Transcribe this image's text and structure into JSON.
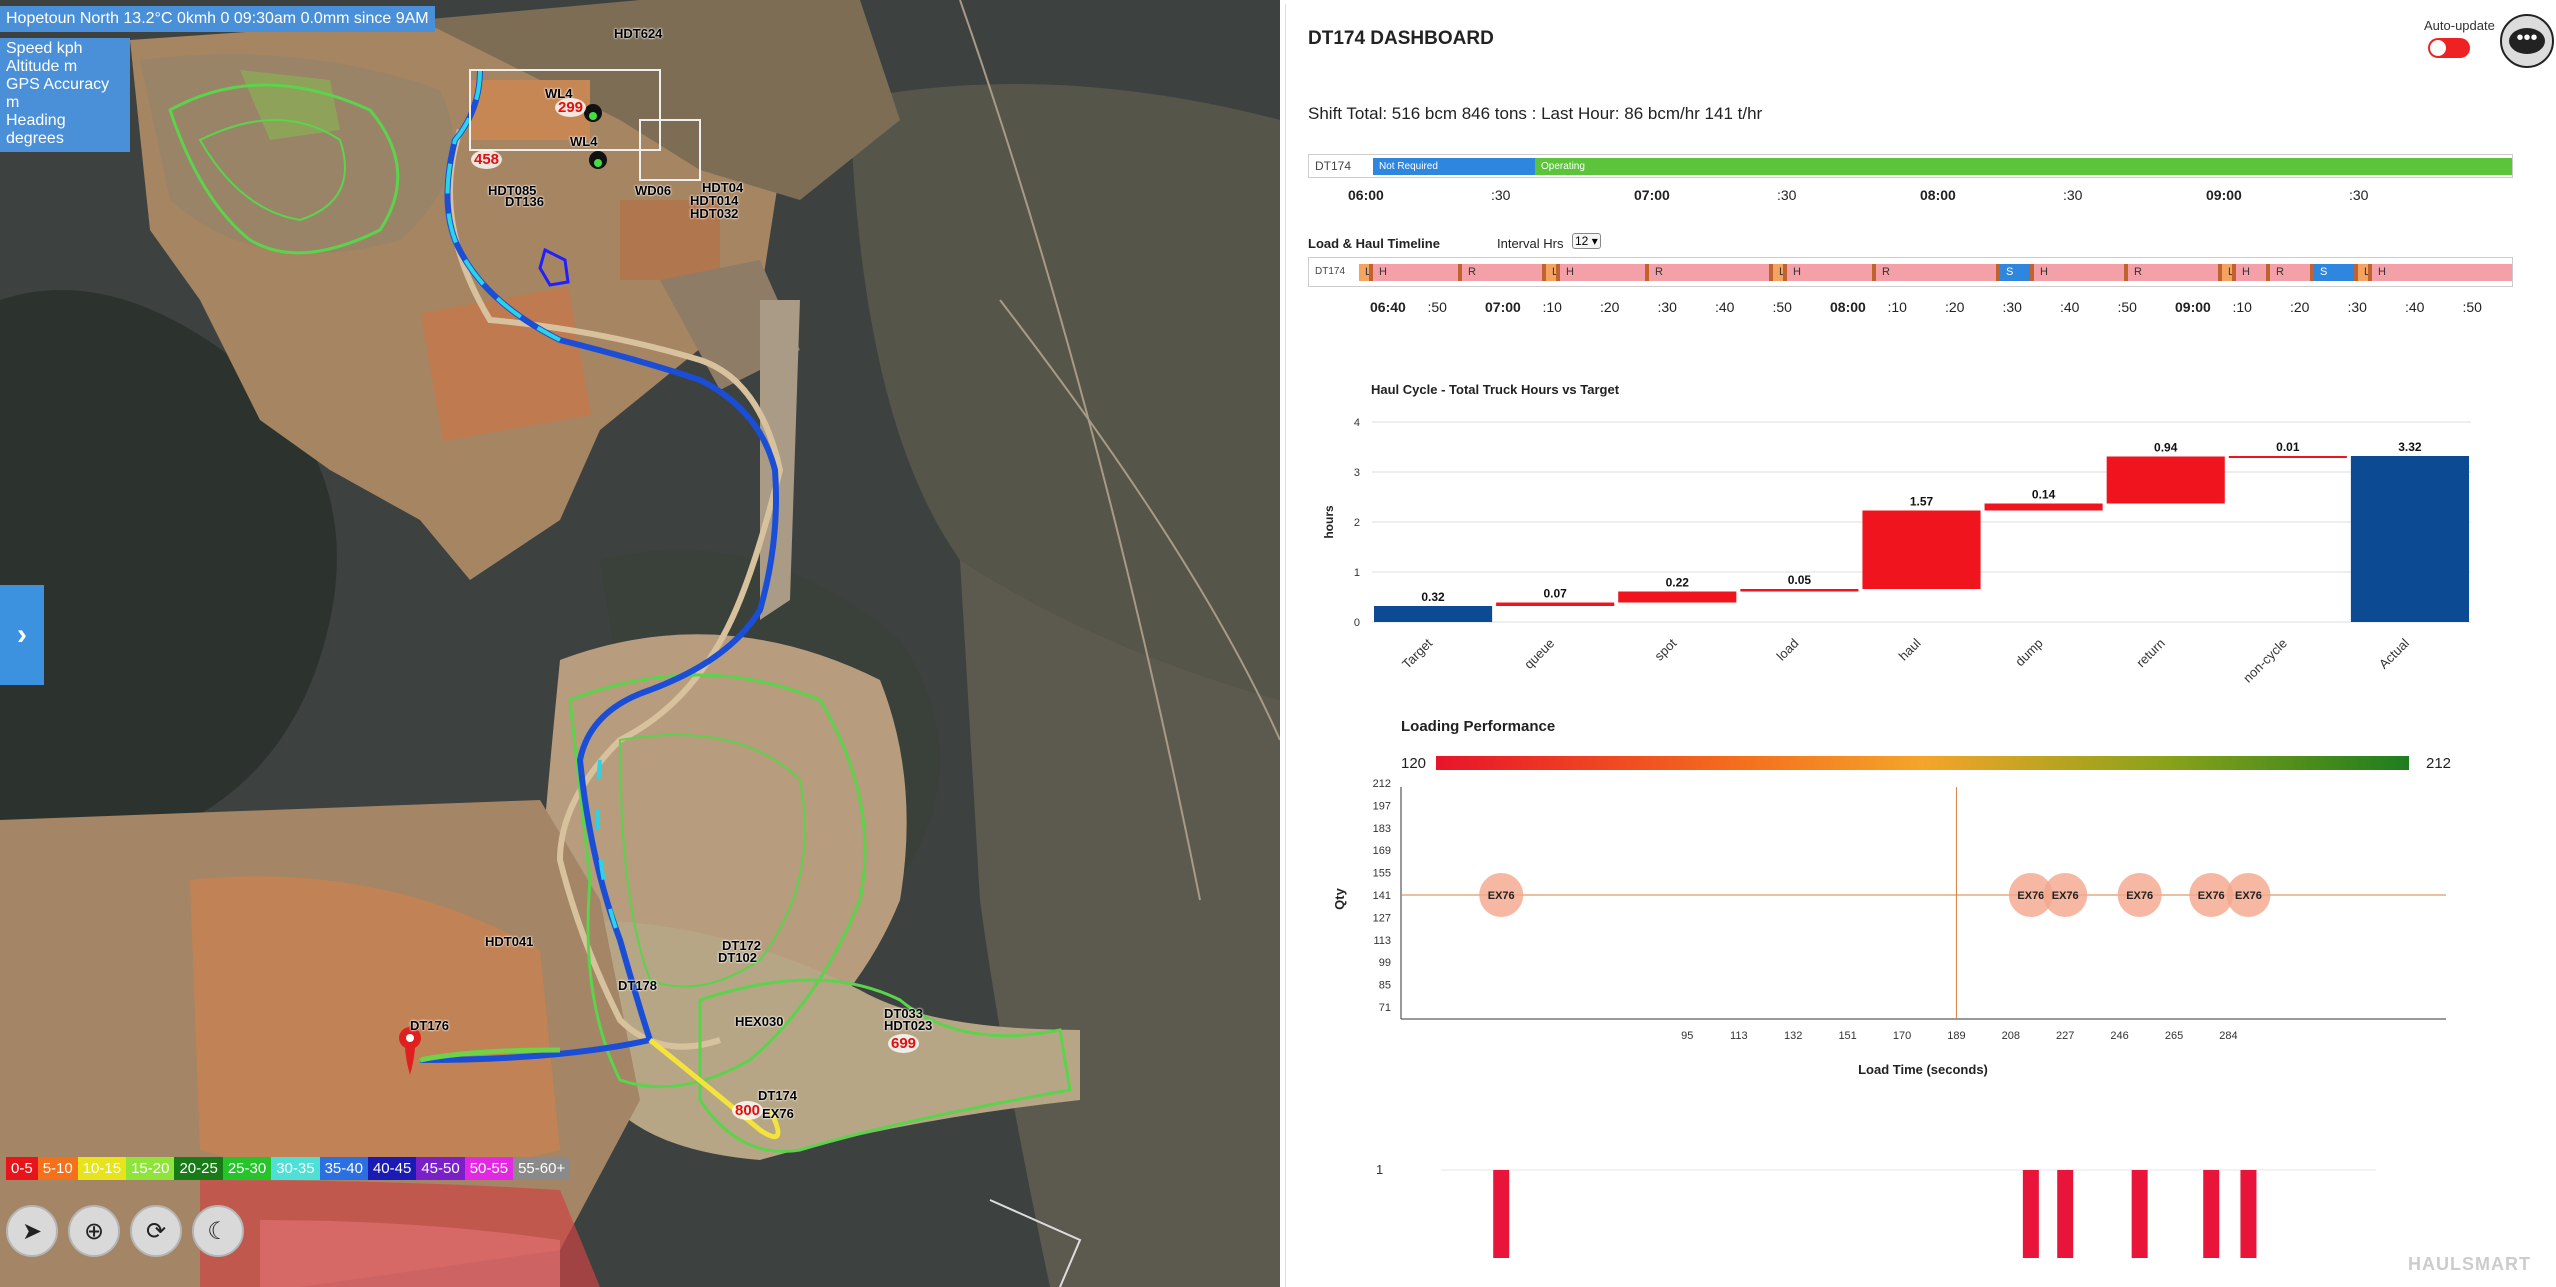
{
  "map": {
    "weather": "Hopetoun North 13.2°C 0kmh 0 09:30am 0.0mm since 9AM",
    "info_lines": [
      "Speed kph",
      "Altitude m",
      "GPS Accuracy m",
      "Heading degrees"
    ],
    "labels": [
      "HDT624",
      "WL4",
      "WL4",
      "HDT085",
      "DT136",
      "WD06",
      "HDT04",
      "HDT014",
      "HDT032",
      "HEX030",
      "DT176",
      "DT172",
      "DT102",
      "DT178",
      "HDT041",
      "DT033",
      "DT174",
      "EX76",
      "HDT023"
    ],
    "numbers": [
      "299",
      "458",
      "699",
      "800"
    ],
    "speed_legend": [
      {
        "label": "0-5",
        "color": "#e8141b"
      },
      {
        "label": "5-10",
        "color": "#f4701b"
      },
      {
        "label": "10-15",
        "color": "#e8e41b"
      },
      {
        "label": "15-20",
        "color": "#8fe43a"
      },
      {
        "label": "20-25",
        "color": "#177b17"
      },
      {
        "label": "25-30",
        "color": "#26c42b"
      },
      {
        "label": "30-35",
        "color": "#4ee0d6"
      },
      {
        "label": "35-40",
        "color": "#2b6fe0"
      },
      {
        "label": "40-45",
        "color": "#1a1ab4"
      },
      {
        "label": "45-50",
        "color": "#7a20c8"
      },
      {
        "label": "50-55",
        "color": "#e228e2"
      },
      {
        "label": "55-60+",
        "color": "#8a8a8a"
      }
    ],
    "tools": [
      "navigate-icon",
      "crosshair-icon",
      "refresh-icon",
      "night-mode-icon"
    ],
    "side_arrow": "›"
  },
  "dashboard": {
    "title": "DT174 DASHBOARD",
    "auto_update_label": "Auto-update",
    "chat_glyph": "•••",
    "shift_summary": "Shift Total: 516 bcm 846 tons : Last Hour: 86 bcm/hr 141 t/hr",
    "status": {
      "truck": "DT174",
      "segments": [
        "Not Required",
        "Operating"
      ],
      "ticks": [
        "06:00",
        ":30",
        "07:00",
        ":30",
        "08:00",
        ":30",
        "09:00",
        ":30"
      ]
    },
    "load_haul": {
      "title": "Load & Haul Timeline",
      "interval_label": "Interval Hrs",
      "interval_value": "12",
      "truck": "DT174",
      "segments": [
        "L",
        "H",
        "R",
        "L",
        "H",
        "R",
        "L",
        "H",
        "R",
        "S",
        "H",
        "R",
        "L",
        "H",
        "R",
        "S",
        "L",
        "H",
        "R"
      ],
      "ticks": [
        "06:40",
        ":50",
        "07:00",
        ":10",
        ":20",
        ":30",
        ":40",
        ":50",
        "08:00",
        ":10",
        ":20",
        ":30",
        ":40",
        ":50",
        "09:00",
        ":10",
        ":20",
        ":30",
        ":40",
        ":50"
      ]
    },
    "brand": "HAULSMART"
  },
  "chart_data": [
    {
      "type": "bar",
      "title": "Haul Cycle - Total Truck Hours vs Target",
      "ylabel": "hours",
      "xlabel": "",
      "ylim": [
        0,
        4
      ],
      "yticks": [
        0,
        1,
        2,
        3,
        4
      ],
      "categories": [
        "Target",
        "queue",
        "spot",
        "load",
        "haul",
        "dump",
        "return",
        "non-cycle",
        "Actual"
      ],
      "values": [
        0.32,
        0.07,
        0.22,
        0.05,
        1.57,
        0.14,
        0.94,
        0.01,
        3.32
      ],
      "labels": [
        "0.32",
        "0.07",
        "0.22",
        "0.05",
        "1.57",
        "0.14",
        "0.94",
        "0.01",
        "3.32"
      ],
      "waterfall": true,
      "colors": {
        "total": "#0d4a94",
        "step": "#f0141e"
      }
    },
    {
      "type": "scatter",
      "title": "Loading Performance",
      "xlabel": "Load Time (seconds)",
      "ylabel": "Qty",
      "color_scale": {
        "min": "120",
        "max": "212"
      },
      "yticks": [
        "212",
        "197",
        "183",
        "169",
        "155",
        "141",
        "127",
        "113",
        "99",
        "85",
        "71"
      ],
      "xticks": [
        "95",
        "113",
        "132",
        "151",
        "170",
        "189",
        "208",
        "227",
        "246",
        "265",
        "284"
      ],
      "ref_x": 189,
      "ref_y": 141,
      "points": [
        {
          "x": 30,
          "y": 141,
          "label": "EX76"
        },
        {
          "x": 215,
          "y": 141,
          "label": "EX76"
        },
        {
          "x": 227,
          "y": 141,
          "label": "EX76"
        },
        {
          "x": 253,
          "y": 141,
          "label": "EX76"
        },
        {
          "x": 278,
          "y": 141,
          "label": "EX76"
        },
        {
          "x": 291,
          "y": 141,
          "label": "EX76"
        }
      ]
    },
    {
      "type": "bar",
      "title": "",
      "yticks": [
        "1"
      ],
      "x": [
        30,
        215,
        227,
        253,
        278,
        291
      ],
      "values": [
        1,
        1,
        1,
        1,
        1,
        1
      ],
      "color": "#e8143a"
    }
  ]
}
